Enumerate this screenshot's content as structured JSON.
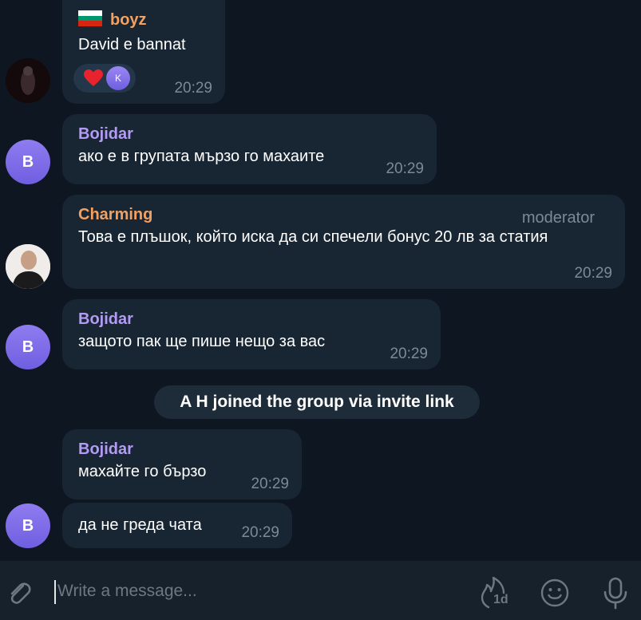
{
  "messages": [
    {
      "sender": "boyz",
      "text": "David e bannat",
      "time": "20:29",
      "reaction_user_initial": "K"
    },
    {
      "sender": "Bojidar",
      "text": "ако е в групата мързо го махаите",
      "time": "20:29"
    },
    {
      "sender": "Charming",
      "role": "moderator",
      "text": "Това е плъшок, който иска да си спечели бонус 20 лв за статия",
      "time": "20:29"
    },
    {
      "sender": "Bojidar",
      "text": "защото пак ще пише нещо за вас",
      "time": "20:29"
    },
    {
      "sender": "Bojidar",
      "text": "махайте го бързо",
      "time": "20:29"
    },
    {
      "text": "да не греда чата",
      "time": "20:29"
    }
  ],
  "avatars": {
    "bojidar_initial": "B"
  },
  "service_message": "A H joined the group via invite link",
  "composer": {
    "placeholder": "Write a message...",
    "timer_label": "1d"
  },
  "colors": {
    "background": "#0e1621",
    "bubble": "#182533",
    "composer": "#17212b",
    "sender_orange": "#f4a15f",
    "sender_purple": "#b39bf5",
    "meta_text": "#7b8a99"
  }
}
